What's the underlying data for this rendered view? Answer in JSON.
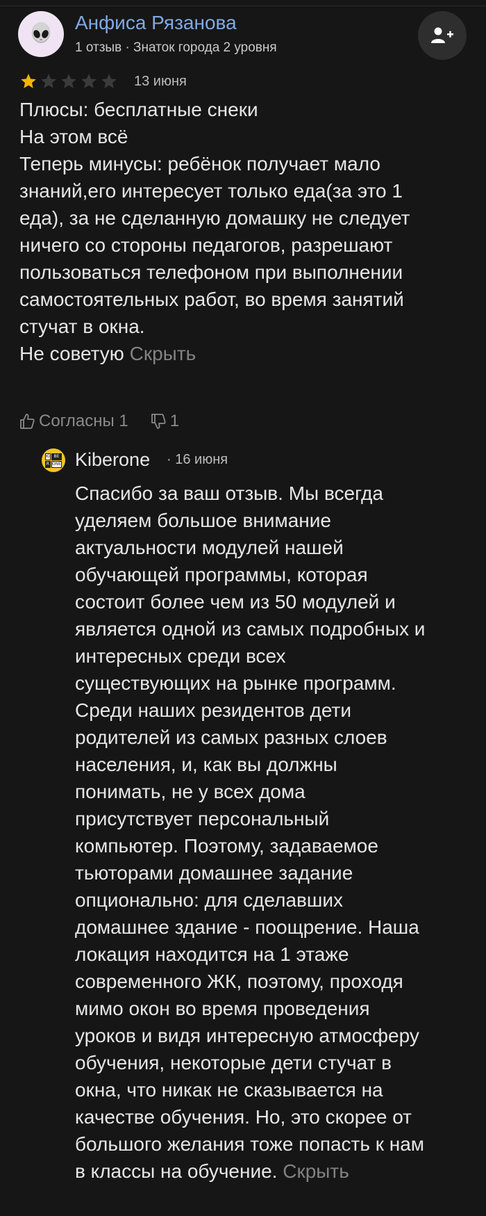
{
  "author": {
    "name": "Анфиса Рязанова",
    "meta": "1 отзыв · Знаток города 2 уровня",
    "avatar_icon": "alien-icon"
  },
  "subscribe_icon": "add-user-icon",
  "review": {
    "rating": 1,
    "max_rating": 5,
    "date": "13 июня",
    "lines": [
      "Плюсы: бесплатные снеки",
      "На этом всё",
      "Теперь минусы: ребёнок получает мало",
      "знаний,его интересует только еда(за это 1",
      "еда), за не сделанную домашку не следует",
      "ничего со стороны педагогов, разрешают",
      "пользоваться телефоном при выполнении",
      "самостоятельных работ, во время занятий",
      "стучат в окна."
    ],
    "last_line": "Не советую",
    "hide_label": "Скрыть"
  },
  "reactions": {
    "like_label": "Согласны 1",
    "dislike_count": "1"
  },
  "response": {
    "name": "Kiberone",
    "date": "· 16 июня",
    "lines": [
      "Спасибо за ваш отзыв. Мы всегда",
      "уделяем большое внимание",
      "актуальности модулей нашей",
      "обучающей программы, которая",
      "состоит более чем из 50 модулей и",
      "является одной из самых подробных и",
      "интересных среди всех",
      "существующих на рынке программ.",
      "Среди наших резидентов дети",
      "родителей из самых разных слоев",
      "населения, и, как вы должны",
      "понимать, не у всех дома",
      "присутствует персональный",
      "компьютер. Поэтому, задаваемое",
      "тьюторами домашнее задание",
      "опционально: для сделавших",
      "домашнее здание - поощрение. Наша",
      "локация находится на 1 этаже",
      "современного ЖК, поэтому,  проходя",
      "мимо окон во время проведения",
      "уроков и видя интересную атмосферу",
      "обучения, некоторые дети стучат в",
      "окна, что никак не сказывается на",
      "качестве обучения. Но, это скорее от",
      "большого желания тоже попасть к нам"
    ],
    "last_line": "в классы на обучение.",
    "hide_label": "Скрыть",
    "logo_letters": [
      "KI",
      "BE",
      "R",
      "ONE"
    ]
  },
  "colors": {
    "background": "#161616",
    "author_name": "#7fa9e6",
    "star_filled": "#f7b500",
    "star_empty": "#3b3b3b",
    "link_muted": "#828282"
  }
}
